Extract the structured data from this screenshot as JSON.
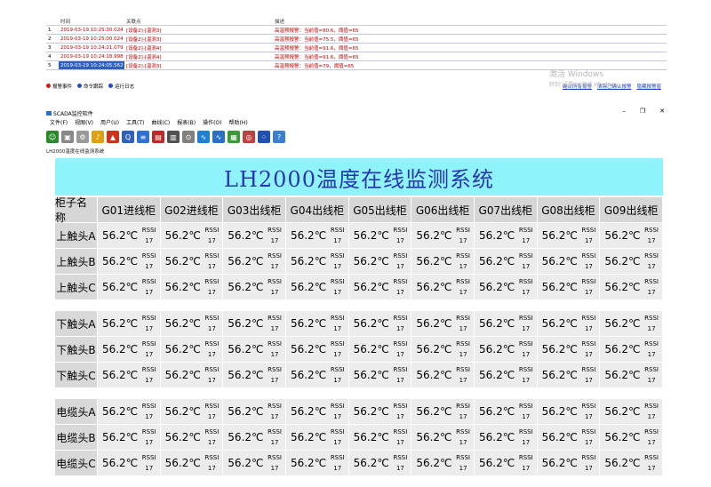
{
  "alarm_panel": {
    "headers": {
      "time": "时间",
      "source": "关联点",
      "desc": "描述"
    },
    "rows": [
      {
        "n": "1",
        "time": "2019-03-19 10:25:30.024",
        "src": "[设备2]-[温测3]",
        "desc": "高温预报警：当前值=80.6，阈值=65"
      },
      {
        "n": "2",
        "time": "2019-03-19 10:25:00.024",
        "src": "[设备2]-[温测3]",
        "desc": "高温预报警：当前值=75.5，阈值=65"
      },
      {
        "n": "3",
        "time": "2019-03-19 10:24:21.079",
        "src": "[设备2]-[温测4]",
        "desc": "高温预报警：当前值=91.6，阈值=65"
      },
      {
        "n": "4",
        "time": "2019-03-19 10:24:18.998",
        "src": "[设备2]-[温测4]",
        "desc": "高温预报警：当前值=91.6，阈值=65"
      },
      {
        "n": "5",
        "time": "2019-03-19 10:24:05.562",
        "src": "[设备2]-[温测3]",
        "desc": "高温预报警：当前值=79，阈值=65"
      }
    ],
    "tabs": [
      {
        "label": "报警事件",
        "color": "#d01818"
      },
      {
        "label": "命令跟踪",
        "color": "#2050c0"
      },
      {
        "label": "运行日志",
        "color": "#2050c0"
      }
    ],
    "links": [
      "确认所有报警",
      "清除已确认报警",
      "隐藏报警窗"
    ],
    "watermark": "激活 Windows",
    "watermark_sub": "转到“设置”以激活 Windows。"
  },
  "window": {
    "title": "SCADA监控软件",
    "menus": [
      "文件(F)",
      "视图(V)",
      "用户(U)",
      "工具(T)",
      "曲线(C)",
      "报表(B)",
      "操作(O)",
      "帮助(H)"
    ],
    "toolbar_icons": [
      {
        "name": "user-icon",
        "color": "#2a8a2a",
        "glyph": "☺"
      },
      {
        "name": "lock-icon",
        "color": "#888888",
        "glyph": "▣"
      },
      {
        "name": "gear-icon",
        "color": "#9a9a9a",
        "glyph": "⚙"
      },
      {
        "name": "bell-icon",
        "color": "#e0a010",
        "glyph": "♪"
      },
      {
        "name": "alarm-icon",
        "color": "#d03020",
        "glyph": "▲"
      },
      {
        "name": "search-icon",
        "color": "#3060c0",
        "glyph": "Q"
      },
      {
        "name": "list-icon",
        "color": "#3070d0",
        "glyph": "≡"
      },
      {
        "name": "database-icon",
        "color": "#c02828",
        "glyph": "▤"
      },
      {
        "name": "report-icon",
        "color": "#505050",
        "glyph": "▥"
      },
      {
        "name": "zoom-icon",
        "color": "#808080",
        "glyph": "⊙"
      },
      {
        "name": "trend-icon",
        "color": "#2080d0",
        "glyph": "∿"
      },
      {
        "name": "chart-icon",
        "color": "#2a70c8",
        "glyph": "∿"
      },
      {
        "name": "monitor-icon",
        "color": "#3a9a3a",
        "glyph": "▦"
      },
      {
        "name": "globe-icon",
        "color": "#c04040",
        "glyph": "◎"
      },
      {
        "name": "network-icon",
        "color": "#2050b0",
        "glyph": "⁘"
      },
      {
        "name": "help-icon",
        "color": "#3a80d0",
        "glyph": "?"
      }
    ],
    "status_label": "LH2000温度在线监测系统"
  },
  "system": {
    "title": "LH2000温度在线监测系统",
    "columns": [
      "柜子名称",
      "G01进线柜",
      "G02进线柜",
      "G03出线柜",
      "G04出线柜",
      "G05出线柜",
      "G06出线柜",
      "G07出线柜",
      "G08出线柜",
      "G09出线柜"
    ],
    "groups": [
      {
        "rows": [
          "上触头A",
          "上触头B",
          "上触头C"
        ]
      },
      {
        "rows": [
          "下触头A",
          "下触头B",
          "下触头C"
        ]
      },
      {
        "rows": [
          "电缆头A",
          "电缆头B",
          "电缆头C"
        ]
      }
    ],
    "temperature": "56.2℃",
    "rssi_label": "RSSI",
    "rssi_value": "17"
  }
}
